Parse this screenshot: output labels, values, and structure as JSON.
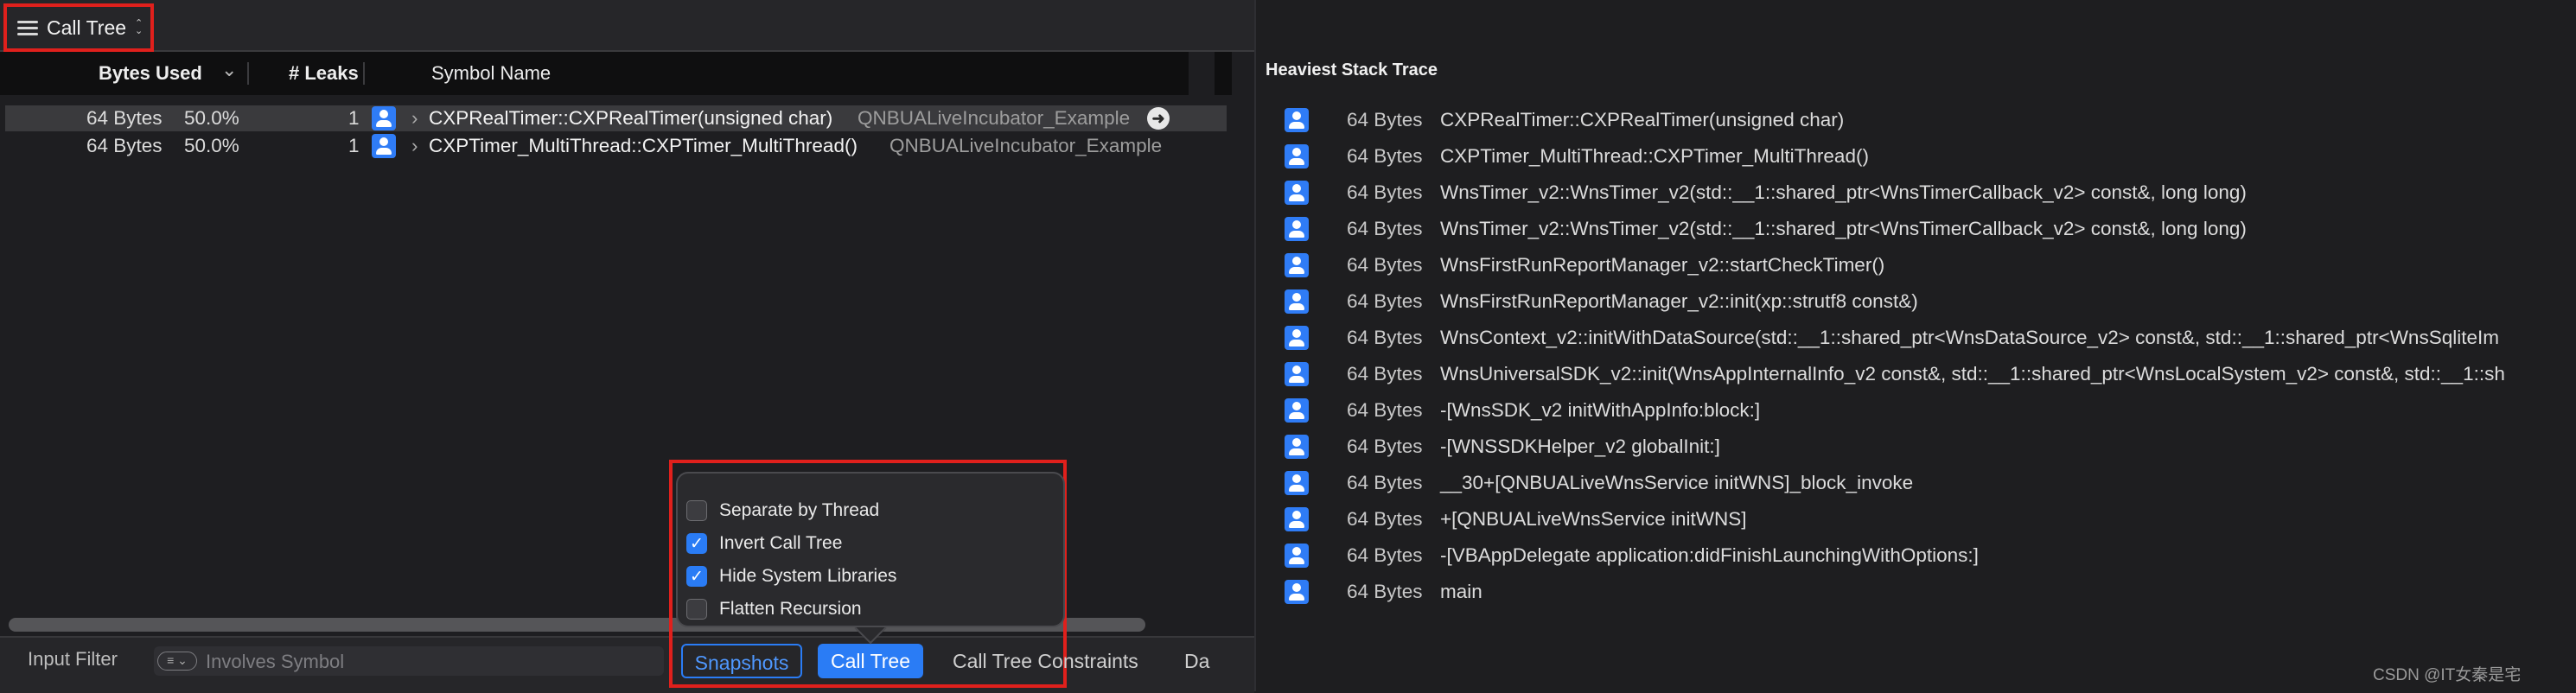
{
  "toolbar": {
    "view_menu_label": "Call Tree",
    "view_menu_chevron": "⌃⌄"
  },
  "table": {
    "headers": {
      "bytes_used": "Bytes Used",
      "sort_chevron": "⌄",
      "leaks": "# Leaks",
      "symbol": "Symbol Name"
    },
    "rows": [
      {
        "bytes": "64 Bytes",
        "percent": "50.0%",
        "leaks": "1",
        "symbol": "CXPRealTimer::CXPRealTimer(unsigned char)",
        "library": "QNBUALiveIncubator_Example",
        "selected": true
      },
      {
        "bytes": "64 Bytes",
        "percent": "50.0%",
        "leaks": "1",
        "symbol": "CXPTimer_MultiThread::CXPTimer_MultiThread()",
        "library": "QNBUALiveIncubator_Example",
        "selected": false
      }
    ]
  },
  "popover": {
    "options": [
      {
        "label": "Separate by Thread",
        "checked": false
      },
      {
        "label": "Invert Call Tree",
        "checked": true
      },
      {
        "label": "Hide System Libraries",
        "checked": true
      },
      {
        "label": "Flatten Recursion",
        "checked": false
      }
    ]
  },
  "bottom_bar": {
    "input_filter_label": "Input Filter",
    "filter_placeholder": "Involves Symbol",
    "tabs": {
      "snapshots": "Snapshots",
      "call_tree": "Call Tree",
      "constraints": "Call Tree Constraints",
      "truncated": "Da"
    }
  },
  "stack_trace": {
    "title": "Heaviest Stack Trace",
    "frames": [
      {
        "size": "64 Bytes",
        "symbol": "CXPRealTimer::CXPRealTimer(unsigned char)"
      },
      {
        "size": "64 Bytes",
        "symbol": "CXPTimer_MultiThread::CXPTimer_MultiThread()"
      },
      {
        "size": "64 Bytes",
        "symbol": "WnsTimer_v2::WnsTimer_v2(std::__1::shared_ptr<WnsTimerCallback_v2> const&, long long)"
      },
      {
        "size": "64 Bytes",
        "symbol": "WnsTimer_v2::WnsTimer_v2(std::__1::shared_ptr<WnsTimerCallback_v2> const&, long long)"
      },
      {
        "size": "64 Bytes",
        "symbol": "WnsFirstRunReportManager_v2::startCheckTimer()"
      },
      {
        "size": "64 Bytes",
        "symbol": "WnsFirstRunReportManager_v2::init(xp::strutf8 const&)"
      },
      {
        "size": "64 Bytes",
        "symbol": "WnsContext_v2::initWithDataSource(std::__1::shared_ptr<WnsDataSource_v2> const&, std::__1::shared_ptr<WnsSqliteIm"
      },
      {
        "size": "64 Bytes",
        "symbol": "WnsUniversalSDK_v2::init(WnsAppInternalInfo_v2 const&, std::__1::shared_ptr<WnsLocalSystem_v2> const&, std::__1::sh"
      },
      {
        "size": "64 Bytes",
        "symbol": "-[WnsSDK_v2 initWithAppInfo:block:]"
      },
      {
        "size": "64 Bytes",
        "symbol": "-[WNSSDKHelper_v2 globalInit:]"
      },
      {
        "size": "64 Bytes",
        "symbol": "__30+[QNBUALiveWnsService initWNS]_block_invoke"
      },
      {
        "size": "64 Bytes",
        "symbol": "+[QNBUALiveWnsService initWNS]"
      },
      {
        "size": "64 Bytes",
        "symbol": "-[VBAppDelegate application:didFinishLaunchingWithOptions:]"
      },
      {
        "size": "64 Bytes",
        "symbol": "main"
      }
    ]
  },
  "watermark": "CSDN @IT女秦是宅",
  "colors": {
    "highlight_red": "#e0201c",
    "accent_blue": "#2a7cf5",
    "user_icon_blue": "#2f7cf6"
  },
  "icons": {
    "menu": "hamburger-icon",
    "user": "user-icon",
    "jump": "arrow-right-circle-icon",
    "disclosure": "chevron-right-icon",
    "filter": "filter-icon"
  }
}
